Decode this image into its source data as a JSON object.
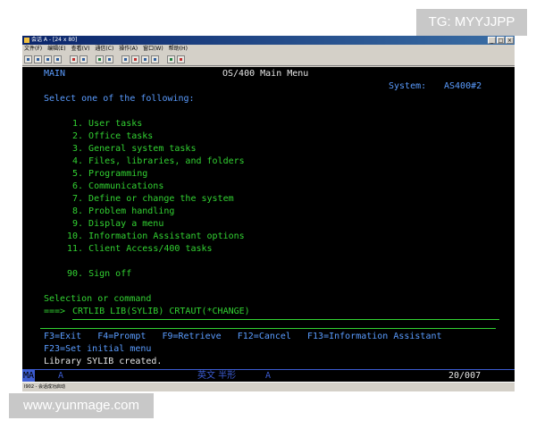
{
  "watermark_top": "TG: MYYJJPP",
  "watermark_bottom": "www.yunmage.com",
  "window": {
    "title": "会话 A - [24 x 80]",
    "controls": [
      "_",
      "□",
      "×"
    ],
    "menu": [
      "文件(F)",
      "编辑(E)",
      "查看(V)",
      "通信(C)",
      "操作(A)",
      "窗口(W)",
      "帮助(H)"
    ]
  },
  "screen": {
    "menu_id": "MAIN",
    "title": "OS/400 Main Menu",
    "system_label": "System:",
    "system_name": "AS400#2",
    "prompt": "Select one of the following:",
    "options": [
      "1. User tasks",
      "2. Office tasks",
      "3. General system tasks",
      "4. Files, libraries, and folders",
      "5. Programming",
      "6. Communications",
      "7. Define or change the system",
      "8. Problem handling",
      "9. Display a menu",
      "10. Information Assistant options",
      "11. Client Access/400 tasks"
    ],
    "signoff": "90. Sign off",
    "selection_label": "Selection or command",
    "command_prompt": "===>",
    "command_value": "CRTLIB LIB(SYLIB) CRTAUT(*CHANGE)",
    "function_keys_1": "F3=Exit   F4=Prompt   F9=Retrieve   F12=Cancel   F13=Information Assistant",
    "function_keys_2": "F23=Set initial menu",
    "message": "Library SYLIB created."
  },
  "status": {
    "mode": "MA",
    "a1": "A",
    "ime": "英文 半形",
    "a2": "A",
    "position": "20/007"
  },
  "bottom_status": "I902 - 会话成功启动",
  "colors": {
    "terminal_bg": "#000000",
    "terminal_green": "#32d232",
    "terminal_white": "#e6e6e6",
    "terminal_blue": "#5a9cff",
    "title_bar": "#0a246a",
    "chrome": "#d4d0c8"
  }
}
